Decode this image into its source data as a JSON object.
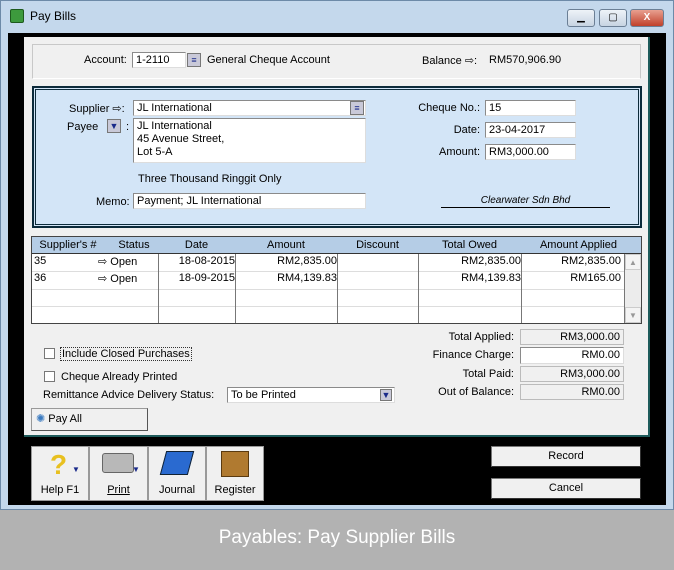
{
  "window": {
    "title": "Pay Bills"
  },
  "account": {
    "label": "Account:",
    "code": "1-2110",
    "name": "General Cheque Account",
    "balance_label": "Balance",
    "balance": "RM570,906.90"
  },
  "cheque": {
    "supplier_label": "Supplier",
    "supplier": "JL International",
    "payee_label": "Payee",
    "payee_lines": [
      "JL International",
      "45 Avenue Street,",
      "Lot 5-A"
    ],
    "amount_words": "Three Thousand Ringgit Only",
    "memo_label": "Memo:",
    "memo": "Payment; JL International",
    "cheque_no_label": "Cheque No.:",
    "cheque_no": "15",
    "date_label": "Date:",
    "date": "23-04-2017",
    "amount_label": "Amount:",
    "amount": "RM3,000.00",
    "signature": "Clearwater Sdn Bhd"
  },
  "table": {
    "headers": [
      "Supplier's #",
      "Status",
      "Date",
      "Amount",
      "Discount",
      "Total Owed",
      "Amount Applied"
    ],
    "rows": [
      {
        "supplier_no": "35",
        "status": "Open",
        "date": "18-08-2015",
        "amount": "RM2,835.00",
        "discount": "",
        "total_owed": "RM2,835.00",
        "applied": "RM2,835.00"
      },
      {
        "supplier_no": "36",
        "status": "Open",
        "date": "18-09-2015",
        "amount": "RM4,139.83",
        "discount": "",
        "total_owed": "RM4,139.83",
        "applied": "RM165.00"
      }
    ]
  },
  "options": {
    "include_closed": "Include Closed Purchases",
    "include_closed_checked": false,
    "already_printed": "Cheque Already Printed",
    "already_printed_checked": false,
    "remittance_label": "Remittance Advice Delivery Status:",
    "remittance_value": "To be Printed"
  },
  "totals": {
    "applied_label": "Total Applied:",
    "applied": "RM3,000.00",
    "finance_label": "Finance Charge:",
    "finance": "RM0.00",
    "paid_label": "Total Paid:",
    "paid": "RM3,000.00",
    "oob_label": "Out of Balance:",
    "oob": "RM0.00"
  },
  "buttons": {
    "pay_all": "Pay All",
    "help": "Help F1",
    "print": "Print",
    "journal": "Journal",
    "register": "Register",
    "record": "Record",
    "cancel": "Cancel"
  },
  "caption": "Payables: Pay Supplier Bills"
}
